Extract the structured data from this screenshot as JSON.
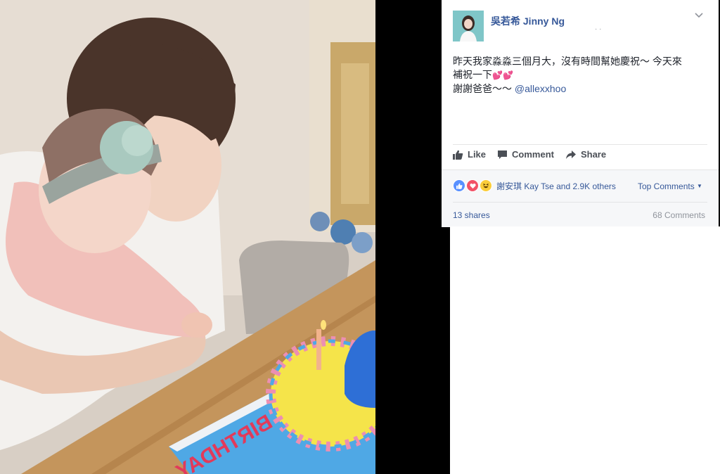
{
  "post": {
    "author": "吳若希 Jinny Ng",
    "text_line1": "昨天我家淼淼三個月大，沒有時間幫她慶祝～ 今天來",
    "text_line2_prefix": "補祝一下",
    "text_line2_emoji": "💕💕",
    "text_line3_prefix": "謝謝爸爸～～ ",
    "mention": "@allexxhoo",
    "photo_cake_text": "BIRTHDAY"
  },
  "actions": {
    "like": "Like",
    "comment": "Comment",
    "share": "Share"
  },
  "stats": {
    "reactions_text": "謝安琪 Kay Tse and 2.9K others",
    "top_comments": "Top Comments",
    "shares": "13 shares",
    "comments": "68 Comments"
  },
  "icons": [
    "like-icon",
    "comment-icon",
    "share-icon",
    "like-reaction-icon",
    "love-reaction-icon",
    "haha-reaction-icon",
    "chevron-down-icon"
  ],
  "colors": {
    "link": "#365899",
    "like_blue": "#5890ff",
    "love_red": "#f25268",
    "haha_yellow": "#fbcd3a"
  }
}
